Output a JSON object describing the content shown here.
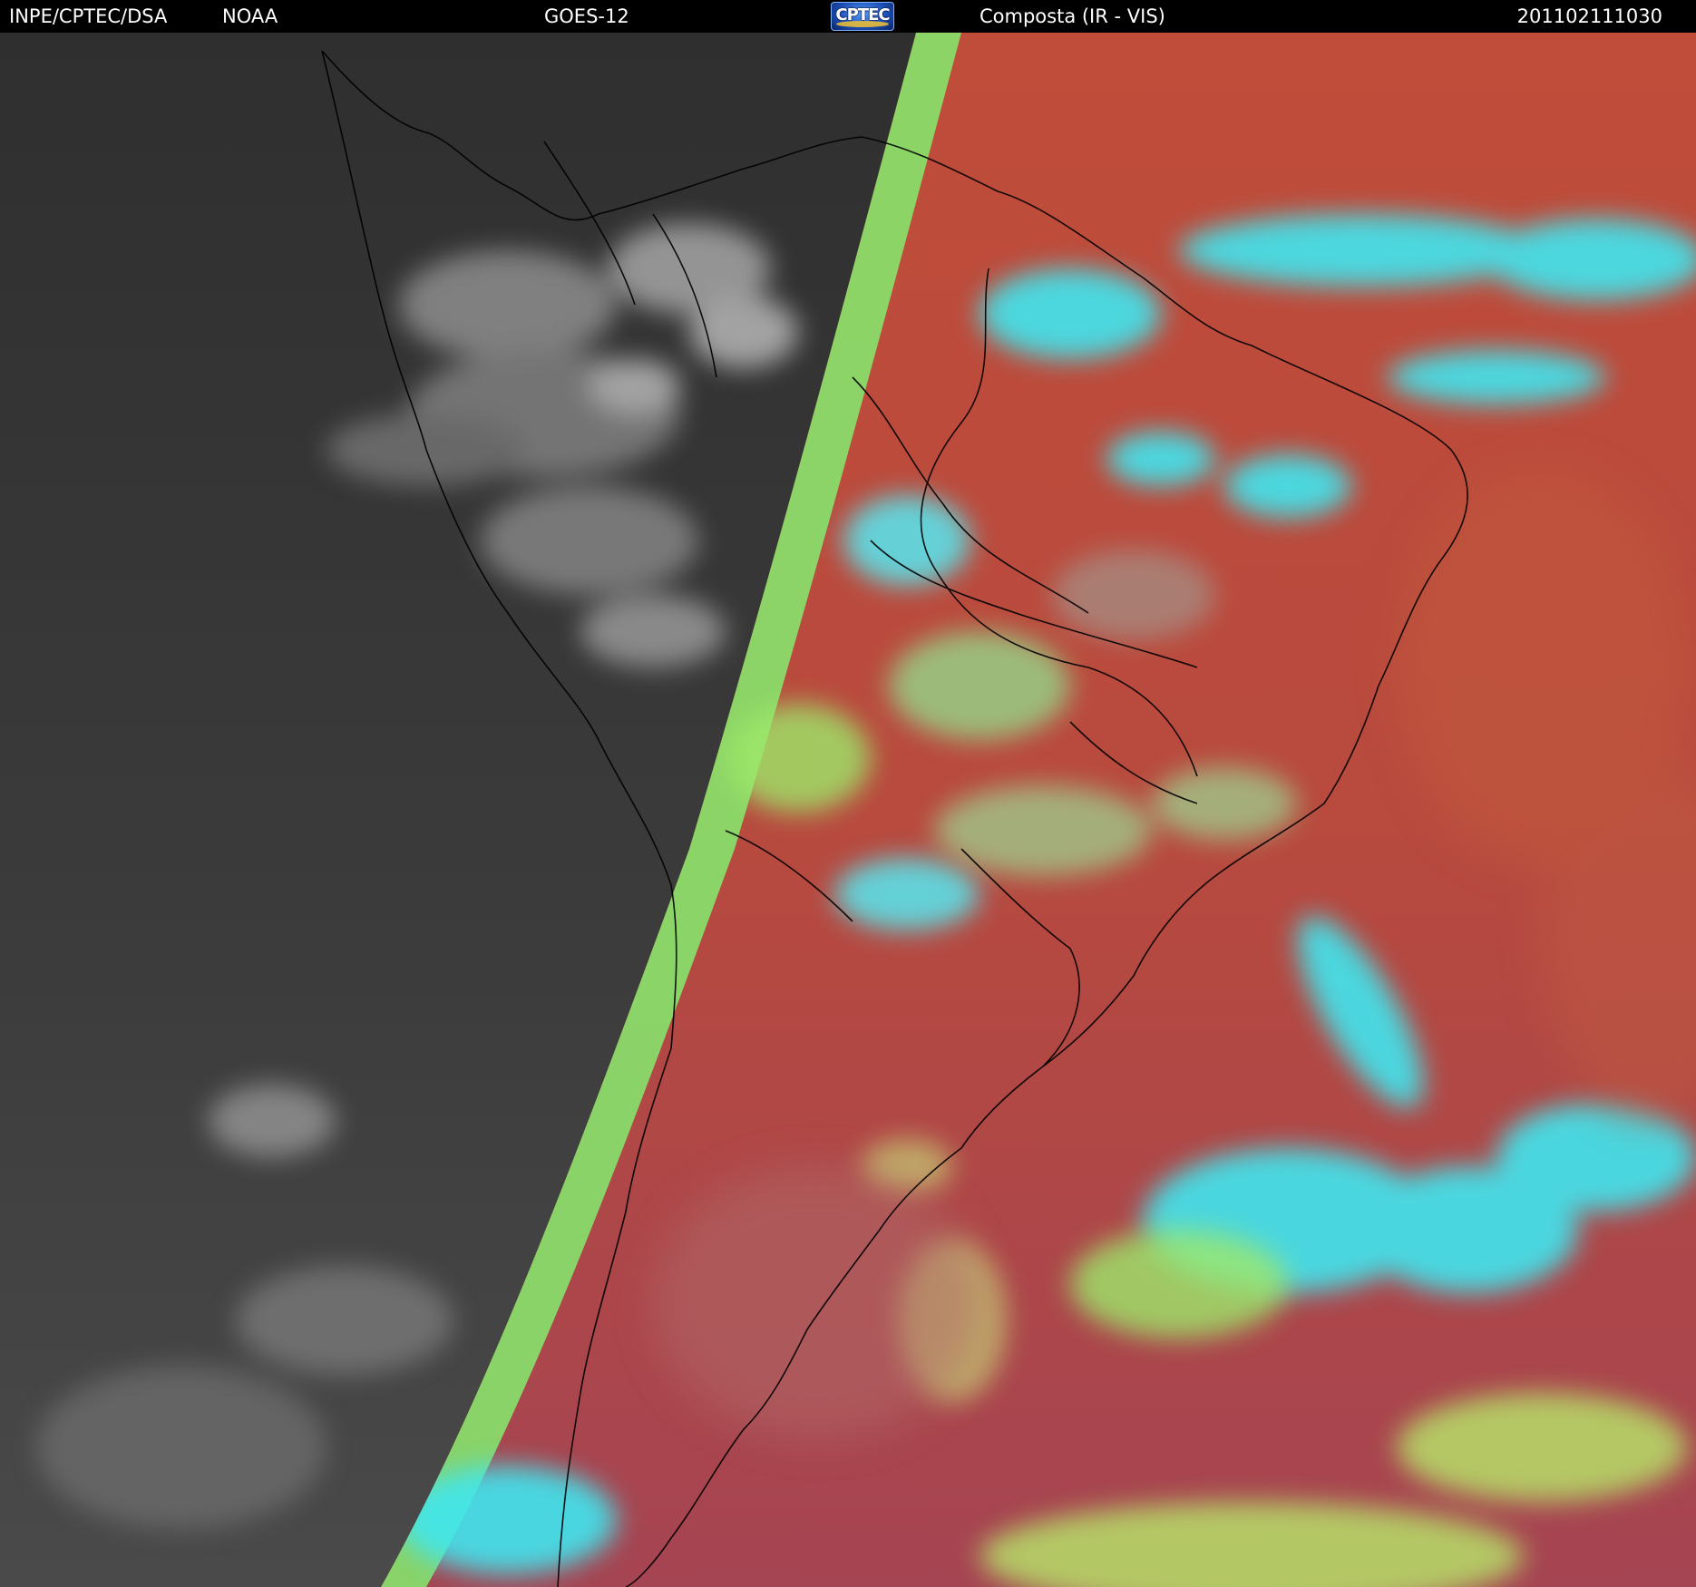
{
  "header": {
    "organization": "INPE/CPTEC/DSA",
    "agency": "NOAA",
    "satellite": "GOES-12",
    "logo_text": "CPTEC",
    "product": "Composta (IR - VIS)",
    "timestamp": "201102111030"
  },
  "colors": {
    "header_bg": "#000000",
    "header_text": "#ffffff",
    "night_ir_gray": "#3a3a3a",
    "day_ocean_red": "#b84a3e",
    "cloud_cyan": "#3fe6f0",
    "cloud_green": "#9ee86a",
    "coastline": "#000000"
  },
  "icons": {
    "logo": "cptec-logo-icon"
  }
}
